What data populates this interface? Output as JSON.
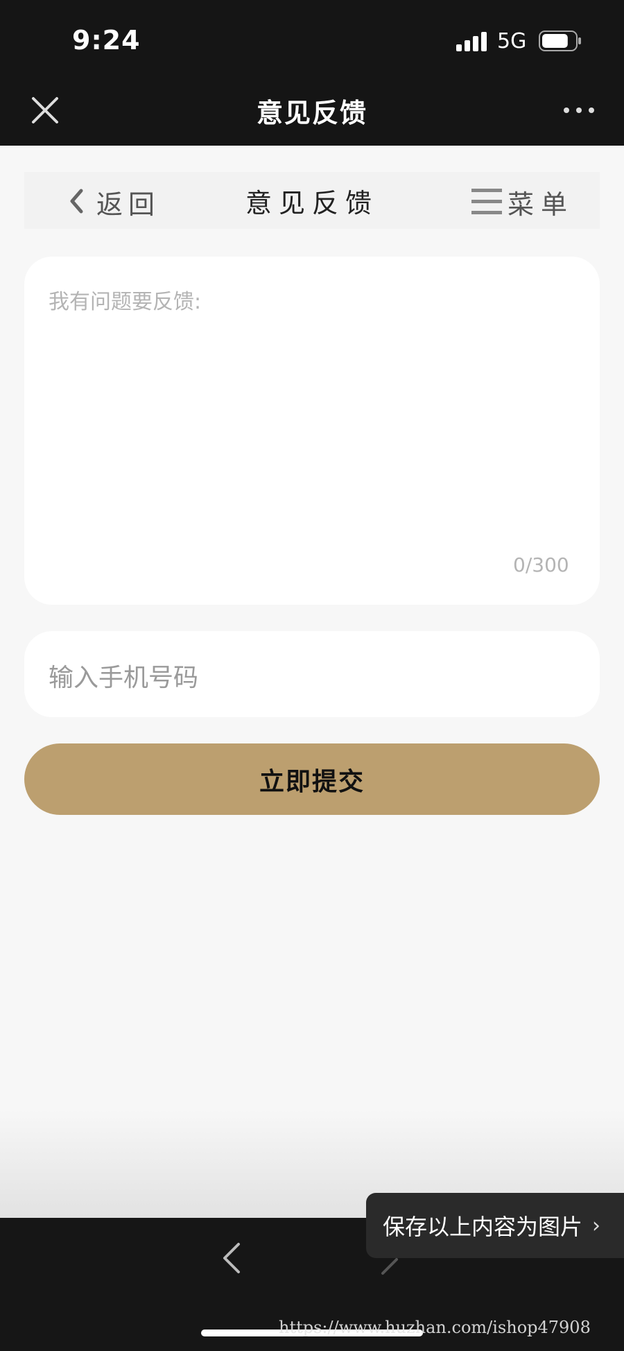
{
  "status_bar": {
    "time": "9:24",
    "network": "5G",
    "battery_level": 0.8
  },
  "wechat_header": {
    "title": "意见反馈",
    "close_icon": "close-icon",
    "more_icon": "more-dots-icon"
  },
  "page_nav": {
    "back_label": "返回",
    "title": "意见反馈",
    "menu_label": "菜单"
  },
  "form": {
    "feedback_placeholder": "我有问题要反馈:",
    "char_counter": "0/300",
    "phone_placeholder": "输入手机号码",
    "submit_label": "立即提交"
  },
  "bottom_bar": {
    "save_toast": "保存以上内容为图片",
    "toast_chevron": "›"
  },
  "watermark": "https://www.huzhan.com/ishop47908",
  "colors": {
    "accent": "#bc9f6f",
    "dark_bar": "#151515",
    "page_bg": "#f7f7f7"
  }
}
